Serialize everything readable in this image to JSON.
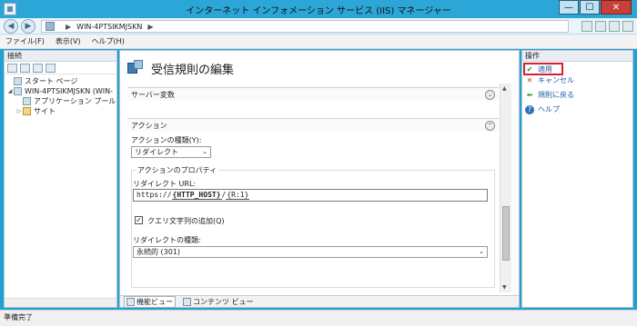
{
  "window": {
    "title": "インターネット インフォメーション サービス (IIS) マネージャー",
    "minimize": "—",
    "maximize": "☐",
    "close": "✕"
  },
  "address": {
    "path": "WIN-4PTSIKMJSKN",
    "separator": "▶",
    "icons": [
      "server-icon"
    ]
  },
  "menu": {
    "items": [
      "ファイル(F)",
      "表示(V)",
      "ヘルプ(H)"
    ]
  },
  "connections": {
    "title": "接続",
    "tree": [
      {
        "label": "スタート ページ",
        "indent": 0,
        "toggle": ""
      },
      {
        "label": "WIN-4PTSIKMJSKN (WIN-",
        "indent": 0,
        "toggle": "◢"
      },
      {
        "label": "アプリケーション プール",
        "indent": 1,
        "toggle": ""
      },
      {
        "label": "サイト",
        "indent": 1,
        "toggle": "▷"
      }
    ]
  },
  "main": {
    "title": "受信規則の編集",
    "server_vars_label": "サーバー変数",
    "action_section_label": "アクション",
    "action_type_label": "アクションの種類(Y):",
    "action_type_value": "リダイレクト",
    "action_props_label": "アクションのプロパティ",
    "redirect_url_label": "リダイレクト URL:",
    "redirect_url_prefix": "https://",
    "redirect_url_token1": "{HTTP_HOST}",
    "redirect_url_slash": "/",
    "redirect_url_token2": "{R:1}",
    "append_query_label": "クエリ文字列の追加(Q)",
    "append_query_checked": "✓",
    "redirect_type_label": "リダイレクトの種類:",
    "redirect_type_value": "永続的 (301)",
    "chevron_down": "⌄",
    "chevron_up": "⌃",
    "dropdown_arrow": "⌄"
  },
  "view_tabs": {
    "features": "機能ビュー",
    "content": "コンテンツ ビュー"
  },
  "actions": {
    "title": "操作",
    "items": [
      "適用",
      "キャンセル",
      "規則に戻る",
      "ヘルプ"
    ],
    "icons": [
      "✔",
      "✕",
      "⬅",
      "?"
    ]
  },
  "status": {
    "text": "準備完了"
  },
  "colors": {
    "accent": "#1c5da8",
    "highlight": "#d8202a"
  }
}
